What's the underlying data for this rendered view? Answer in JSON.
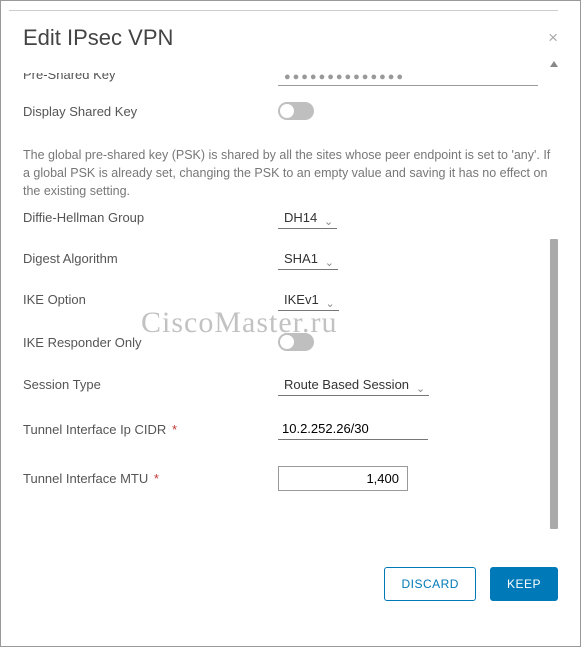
{
  "dialog": {
    "title": "Edit IPsec VPN",
    "close_glyph": "×"
  },
  "fields": {
    "psk_label": "Pre-Shared Key",
    "psk_value": "●●●●●●●●●●●●●●",
    "display_shared_key_label": "Display Shared Key",
    "helptext": "The global pre-shared key (PSK) is shared by all the sites whose peer endpoint is set to 'any'. If a global PSK is already set, changing the PSK to an empty value and saving it has no effect on the existing setting.",
    "dh_group_label": "Diffie-Hellman Group",
    "dh_group_value": "DH14",
    "digest_label": "Digest Algorithm",
    "digest_value": "SHA1",
    "ike_option_label": "IKE Option",
    "ike_option_value": "IKEv1",
    "ike_responder_label": "IKE Responder Only",
    "session_type_label": "Session Type",
    "session_type_value": "Route Based Session",
    "tunnel_cidr_label": "Tunnel Interface Ip CIDR",
    "tunnel_cidr_value": "10.2.252.26/30",
    "tunnel_mtu_label": "Tunnel Interface MTU",
    "tunnel_mtu_value": "1,400",
    "required_mark": "*"
  },
  "footer": {
    "discard": "DISCARD",
    "keep": "KEEP"
  },
  "watermark": "CiscoMaster.ru"
}
